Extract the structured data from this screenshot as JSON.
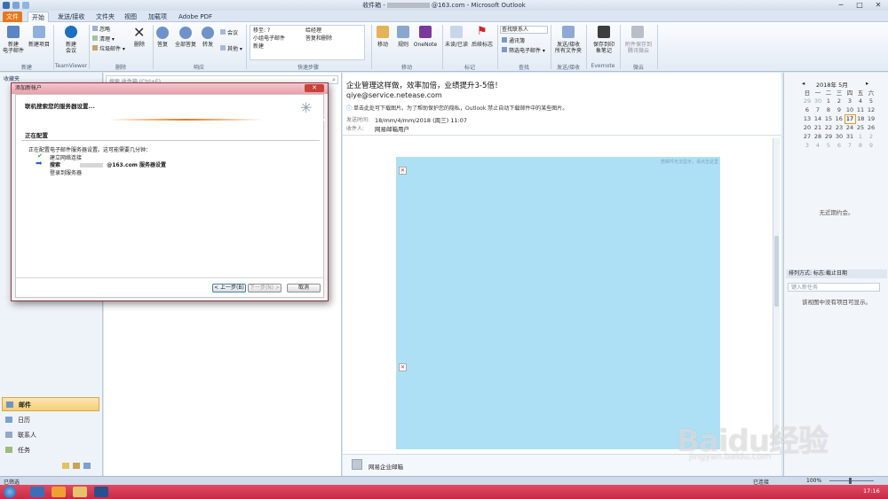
{
  "window": {
    "title_prefix": "收件箱 -",
    "title_account": "@163.com - Microsoft Outlook",
    "controls": [
      "─",
      "□",
      "✕"
    ]
  },
  "tabs": [
    "文件",
    "开始",
    "发送/接收",
    "文件夹",
    "视图",
    "加载项",
    "Adobe PDF"
  ],
  "ribbon": {
    "new": {
      "new_email": "新建\n电子邮件",
      "new_items": "新建项目",
      "group": "新建"
    },
    "teamviewer": {
      "new_meeting": "新建\n会议",
      "group": "TeamViewer"
    },
    "delete": {
      "ignore": "忽略",
      "clean": "清理",
      "junk": "垃圾邮件",
      "delete": "删除",
      "group": "删除"
    },
    "respond": {
      "reply": "答复",
      "reply_all": "全部答复",
      "forward": "转发",
      "meeting": "会议",
      "more": "其他",
      "group": "响应"
    },
    "quicksteps": {
      "items": [
        "移至: ?",
        "小组电子邮件",
        "新建",
        "给经理",
        "答复和删除"
      ],
      "group": "快速步骤"
    },
    "move": {
      "move": "移动",
      "rules": "规则",
      "onenote": "OneNote",
      "group": "移动"
    },
    "tags": {
      "unread": "未读/已读",
      "followup": "后续标志",
      "group": "标记"
    },
    "find": {
      "find_contact": "查找联系人",
      "address_book": "通讯簿",
      "filter": "筛选电子邮件",
      "group": "查找"
    },
    "sendrecv": {
      "label": "发送/接收\n所有文件夹",
      "group": "发送/接收"
    },
    "evernote": {
      "label": "保存到印\n象笔记",
      "group": "Evernote"
    },
    "attach": {
      "label": "附件保存到\n腾讯微云",
      "group": "微云"
    }
  },
  "navpane": {
    "header": "收藏夹",
    "items": [
      {
        "icon": "mail-icon",
        "label": "邮件"
      },
      {
        "icon": "calendar-icon",
        "label": "日历"
      },
      {
        "icon": "contacts-icon",
        "label": "联系人"
      },
      {
        "icon": "tasks-icon",
        "label": "任务"
      }
    ]
  },
  "midpane": {
    "search_placeholder": "搜索 收件箱 (Ctrl+E)"
  },
  "message": {
    "subject": "企业管理这样做，效率加倍，业绩提升3-5倍！",
    "sender": "qiye@service.netease.com",
    "info": "单击此处可下载图片。为了帮助保护您的隐私，Outlook 禁止自动下载邮件中的某些图片。",
    "sent_label": "发送时间:",
    "sent_value": "18/mm/4/mm/2018 (周三) 11:07",
    "to_label": "收件人:",
    "to_value": "网易邮箱用户",
    "banner_text": "若邮件无法显示，请点击这里",
    "footer_sender": "网易企业邮箱"
  },
  "dialog": {
    "title": "添加新帐户",
    "heading": "联机搜索您的服务器设置...",
    "section": "正在配置",
    "desc": "正在配置电子邮件服务器设置。这可能需要几分钟：",
    "steps": [
      {
        "label": "建立网络连接",
        "state": "done"
      },
      {
        "label": "搜索",
        "account": "@163.com 服务器设置",
        "state": "current"
      },
      {
        "label": "登录到服务器",
        "state": "pending"
      }
    ],
    "back": "< 上一步(B)",
    "next": "下一步(N) >",
    "cancel": "取消"
  },
  "calendar": {
    "title": "2018年 5月",
    "weekdays": [
      "日",
      "一",
      "二",
      "三",
      "四",
      "五",
      "六"
    ],
    "weeks": [
      [
        "29",
        "30",
        "1",
        "2",
        "3",
        "4",
        "5"
      ],
      [
        "6",
        "7",
        "8",
        "9",
        "10",
        "11",
        "12"
      ],
      [
        "13",
        "14",
        "15",
        "16",
        "17",
        "18",
        "19"
      ],
      [
        "20",
        "21",
        "22",
        "23",
        "24",
        "25",
        "26"
      ],
      [
        "27",
        "28",
        "29",
        "30",
        "31",
        "1",
        "2"
      ],
      [
        "3",
        "4",
        "5",
        "6",
        "7",
        "8",
        "9"
      ]
    ],
    "today": "17",
    "no_appointments": "无近期约会。",
    "arrange": "排列方式: 标志:截止日期",
    "task_placeholder": "键入新任务",
    "no_tasks": "该视图中没有项目可显示。"
  },
  "status": {
    "left": "已筛选",
    "connected": "已连接",
    "zoom": "100%"
  },
  "taskbar": {
    "time": "17:16"
  },
  "watermark": {
    "brand": "Baidu经验",
    "url": "jingyan.baidu.com"
  }
}
